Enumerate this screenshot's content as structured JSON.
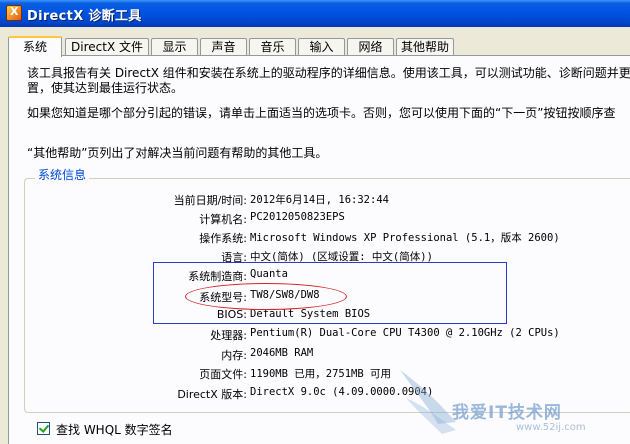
{
  "window": {
    "title": "DirectX 诊断工具"
  },
  "tabs": [
    {
      "label": "系统",
      "active": true
    },
    {
      "label": "DirectX 文件"
    },
    {
      "label": "显示"
    },
    {
      "label": "声音"
    },
    {
      "label": "音乐"
    },
    {
      "label": "输入"
    },
    {
      "label": "网络"
    },
    {
      "label": "其他帮助"
    }
  ],
  "description": {
    "line1": "该工具报告有关 DirectX 组件和安装在系统上的驱动程序的详细信息。使用该工具，可以测试功能、诊断问题并更",
    "line2": "置，使其达到最佳运行状态。",
    "line3": "如果您知道是哪个部分引起的错误，请单击上面适当的选项卡。否则，您可以使用下面的“下一页”按钮按顺序查",
    "line4": "“其他帮助”页列出了对解决当前问题有帮助的其他工具。"
  },
  "system_info": {
    "group_label": "系统信息",
    "rows": [
      {
        "label": "当前日期/时间:",
        "value": "2012年6月14日, 16:32:44"
      },
      {
        "label": "计算机名:",
        "value": "PC2012050823EPS"
      },
      {
        "label": "操作系统:",
        "value": "Microsoft Windows XP Professional (5.1，版本 2600)"
      },
      {
        "label": "语言:",
        "value": "中文(简体) (区域设置: 中文(简体))"
      },
      {
        "label": "系统制造商:",
        "value": "Quanta"
      },
      {
        "label": "系统型号:",
        "value": "TW8/SW8/DW8"
      },
      {
        "label": "BIOS:",
        "value": "Default System BIOS"
      },
      {
        "label": "处理器:",
        "value": "Pentium(R) Dual-Core CPU       T4300  @ 2.10GHz (2 CPUs)"
      },
      {
        "label": "内存:",
        "value": "2046MB RAM"
      },
      {
        "label": "页面文件:",
        "value": "1190MB 已用，2751MB 可用"
      },
      {
        "label": "DirectX 版本:",
        "value": "DirectX 9.0c (4.09.0000.0904)"
      }
    ]
  },
  "whql_check": {
    "label": "查找 WHQL 数字签名",
    "checked": true
  },
  "watermark": {
    "text": "我爱IT技术网",
    "url": "www.52ij.com"
  },
  "colors": {
    "titlebar": "#0055e5",
    "group_label": "#0046d5",
    "highlight_box": "#2a3bd4",
    "highlight_ellipse": "#d2252a"
  }
}
